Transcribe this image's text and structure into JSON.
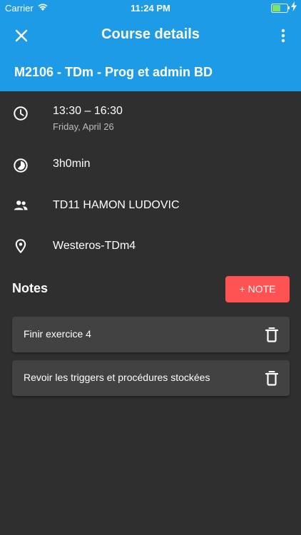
{
  "status_bar": {
    "carrier": "Carrier",
    "time": "11:24 PM",
    "battery_level": 0.55
  },
  "header": {
    "title": "Course details",
    "course_name": "M2106 - TDm - Prog et admin BD",
    "background_color": "#1e9be6"
  },
  "details": {
    "time_range": "13:30  –  16:30",
    "date": "Friday, April 26",
    "duration": "3h0min",
    "group": "TD11 HAMON LUDOVIC",
    "location": "Westeros-TDm4"
  },
  "notes": {
    "title": "Notes",
    "add_label": "+ NOTE",
    "add_color": "#ff5252",
    "items": [
      {
        "text": "Finir exercice 4"
      },
      {
        "text": "Revoir les triggers et procédures stockées"
      }
    ]
  },
  "icons": {
    "close": "close-icon",
    "more": "more-vert-icon",
    "time": "clock-icon",
    "duration": "timelapse-icon",
    "group": "people-icon",
    "location": "location-pin-icon",
    "delete": "trash-icon"
  }
}
